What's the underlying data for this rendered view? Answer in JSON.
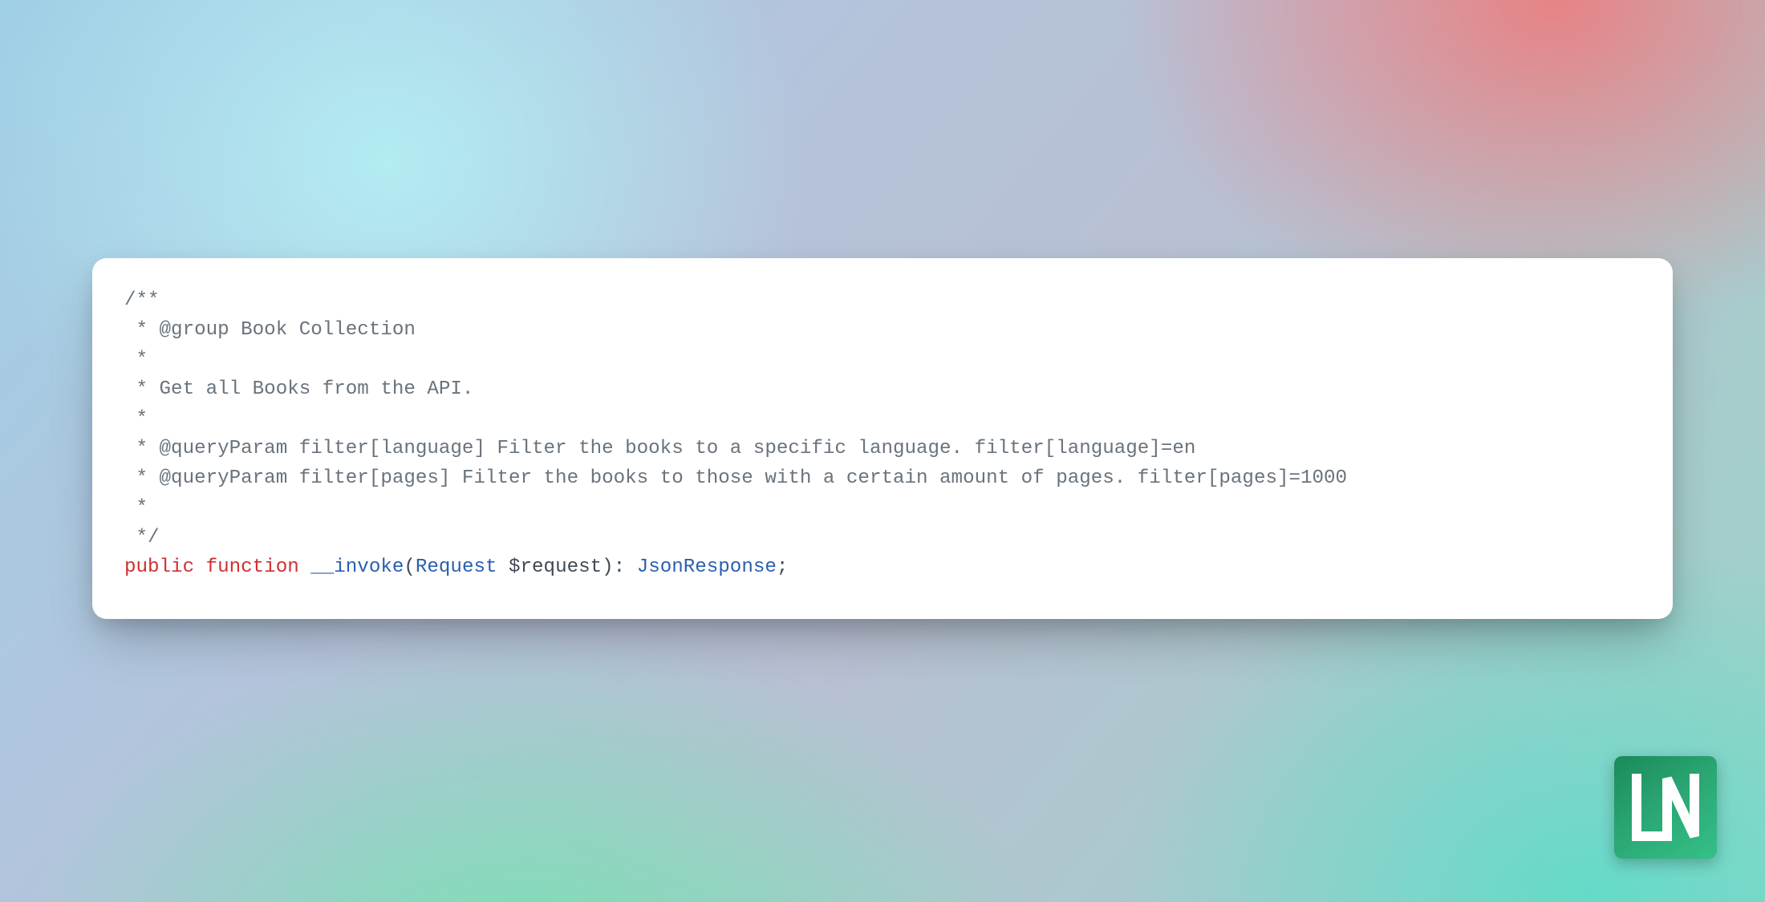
{
  "code": {
    "comment_open": "/**",
    "line_group": " * @group Book Collection",
    "line_blank1": " *",
    "line_desc": " * Get all Books from the API.",
    "line_blank2": " *",
    "line_qp1": " * @queryParam filter[language] Filter the books to a specific language. filter[language]=en",
    "line_qp2": " * @queryParam filter[pages] Filter the books to those with a certain amount of pages. filter[pages]=1000",
    "line_blank3": " *",
    "comment_close": " */",
    "kw_public": "public",
    "kw_function": "function",
    "fn_name": "__invoke",
    "paren_open": "(",
    "param_type": "Request",
    "param_var": "$request",
    "paren_close": ")",
    "colon": ":",
    "return_type": "JsonResponse",
    "semicolon": ";"
  },
  "logo_label": "LN"
}
